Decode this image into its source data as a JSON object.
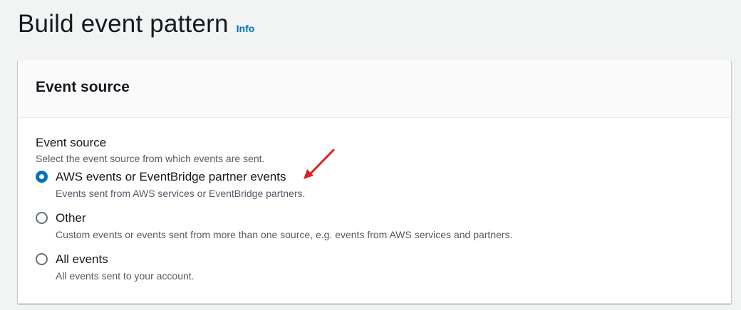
{
  "header": {
    "title": "Build event pattern",
    "info_label": "Info"
  },
  "panel": {
    "title": "Event source",
    "field": {
      "label": "Event source",
      "description": "Select the event source from which events are sent.",
      "options": [
        {
          "label": "AWS events or EventBridge partner events",
          "description": "Events sent from AWS services or EventBridge partners.",
          "selected": true
        },
        {
          "label": "Other",
          "description": "Custom events or events sent from more than one source, e.g. events from AWS services and partners.",
          "selected": false
        },
        {
          "label": "All events",
          "description": "All events sent to your account.",
          "selected": false
        }
      ]
    }
  },
  "colors": {
    "accent": "#0073bb",
    "annotation": "#e02020",
    "background": "#f2f3f3"
  }
}
